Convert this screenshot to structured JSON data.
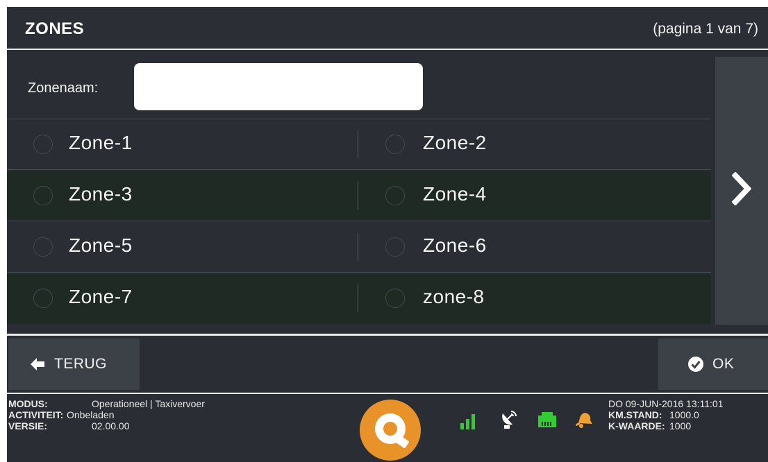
{
  "header": {
    "title": "ZONES",
    "page_indicator": "(pagina 1 van 7)"
  },
  "name_field": {
    "label": "Zonenaam:",
    "value": "",
    "placeholder": ""
  },
  "zones": [
    {
      "label": "Zone-1",
      "selected": false
    },
    {
      "label": "Zone-2",
      "selected": false
    },
    {
      "label": "Zone-3",
      "selected": false
    },
    {
      "label": "Zone-4",
      "selected": false
    },
    {
      "label": "Zone-5",
      "selected": false
    },
    {
      "label": "Zone-6",
      "selected": false
    },
    {
      "label": "Zone-7",
      "selected": false
    },
    {
      "label": "zone-8",
      "selected": false
    }
  ],
  "actions": {
    "back_label": "TERUG",
    "ok_label": "OK"
  },
  "status_left": [
    {
      "key": "MODUS:",
      "value": "Operationeel | Taxivervoer"
    },
    {
      "key": "ACTIVITEIT:",
      "value": "Onbeladen"
    },
    {
      "key": "VERSIE:",
      "value": "02.00.00"
    }
  ],
  "status_right": {
    "datetime": "DO 09-JUN-2016 13:11:01",
    "rows": [
      {
        "key": "KM.STAND:",
        "value": "1000.0"
      },
      {
        "key": "K-WAARDE:",
        "value": "1000"
      }
    ]
  },
  "status_icons": [
    "signal-bars-icon",
    "satellite-dish-icon",
    "network-port-icon",
    "bell-icon"
  ],
  "colors": {
    "status_green": "#33cc33",
    "bell_orange": "#f0a030",
    "logo_orange": "#e8922a",
    "alt_row": "#1f2a24"
  }
}
